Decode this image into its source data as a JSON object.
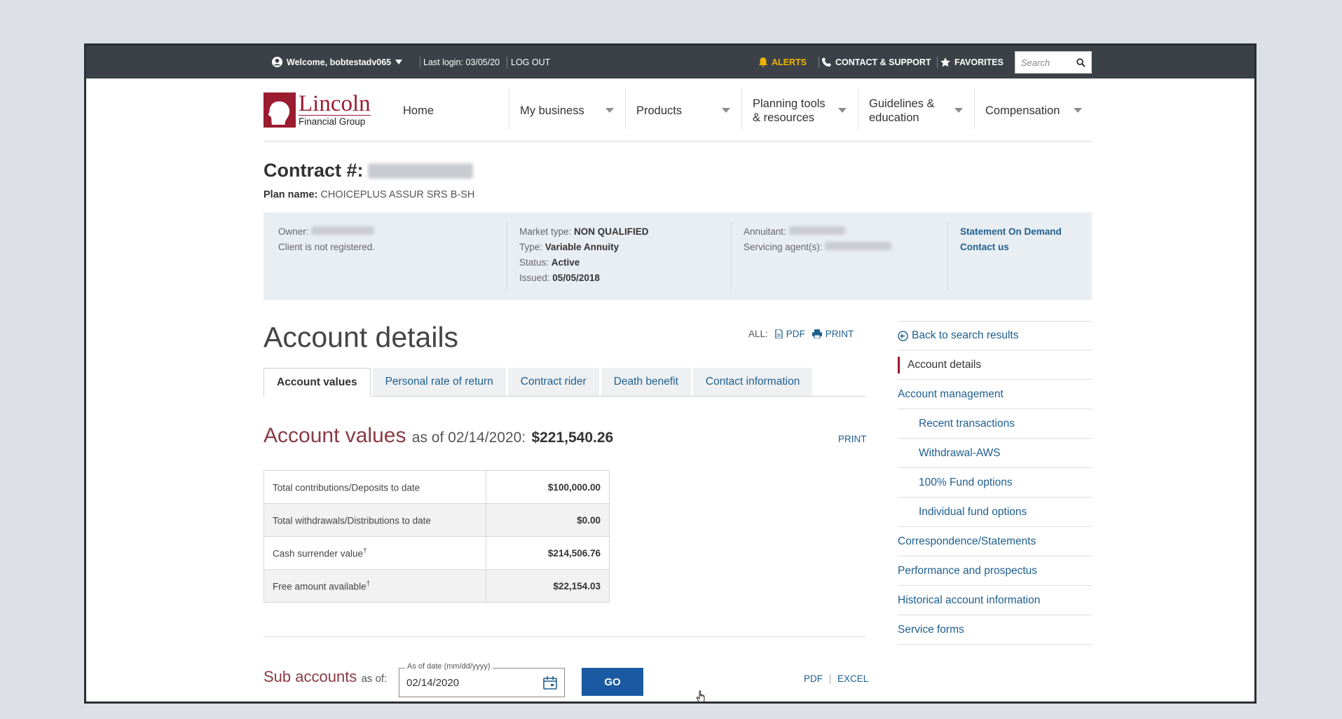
{
  "topbar": {
    "welcome": "Welcome, bobtestadv065",
    "last_login": "Last login: 03/05/20",
    "logout": "LOG OUT",
    "alerts": "ALERTS",
    "contact_support": "CONTACT & SUPPORT",
    "favorites": "FAVORITES",
    "search_placeholder": "Search"
  },
  "logo": {
    "line1": "Lincoln",
    "line2": "Financial Group"
  },
  "nav": {
    "home": "Home",
    "my_business": "My business",
    "products": "Products",
    "planning_1": "Planning tools",
    "planning_2": "& resources",
    "guidelines_1": "Guidelines &",
    "guidelines_2": "education",
    "compensation": "Compensation"
  },
  "contract": {
    "title": "Contract #:",
    "plan_label": "Plan name:",
    "plan_value": "CHOICEPLUS ASSUR SRS B-SH"
  },
  "info": {
    "owner_label": "Owner:",
    "client_status": "Client is not registered.",
    "market_type_label": "Market type:",
    "market_type": "NON QUALIFIED",
    "type_label": "Type:",
    "type": "Variable Annuity",
    "status_label": "Status:",
    "status": "Active",
    "issued_label": "Issued:",
    "issued": "05/05/2018",
    "annuitant_label": "Annuitant:",
    "servicing_label": "Servicing agent(s):",
    "statement_link": "Statement On Demand",
    "contact_link": "Contact us"
  },
  "account_details": {
    "title": "Account details",
    "all_label": "ALL:",
    "pdf": "PDF",
    "print": "PRINT"
  },
  "tabs": [
    "Account values",
    "Personal rate of return",
    "Contract rider",
    "Death benefit",
    "Contact information"
  ],
  "account_values": {
    "title": "Account values",
    "as_of": "as of 02/14/2020:",
    "amount": "$221,540.26",
    "print": "PRINT",
    "rows": [
      {
        "label": "Total contributions/Deposits to date",
        "value": "$100,000.00",
        "dagger": ""
      },
      {
        "label": "Total withdrawals/Distributions to date",
        "value": "$0.00",
        "dagger": ""
      },
      {
        "label": "Cash surrender value",
        "value": "$214,506.76",
        "dagger": "†"
      },
      {
        "label": "Free amount available",
        "value": "$22,154.03",
        "dagger": "†"
      }
    ]
  },
  "sub_accounts": {
    "title": "Sub accounts",
    "as_of": "as of:",
    "date_label": "As of date (mm/dd/yyyy)",
    "date_value": "02/14/2020",
    "go": "GO",
    "pdf": "PDF",
    "excel": "EXCEL"
  },
  "sidebar": {
    "back": "Back to search results",
    "account_details": "Account details",
    "account_management": "Account management",
    "recent_transactions": "Recent transactions",
    "withdrawal": "Withdrawal-AWS",
    "fund_100": "100% Fund options",
    "individual_fund": "Individual fund options",
    "correspondence": "Correspondence/Statements",
    "performance": "Performance and prospectus",
    "historical": "Historical account information",
    "service_forms": "Service forms"
  }
}
